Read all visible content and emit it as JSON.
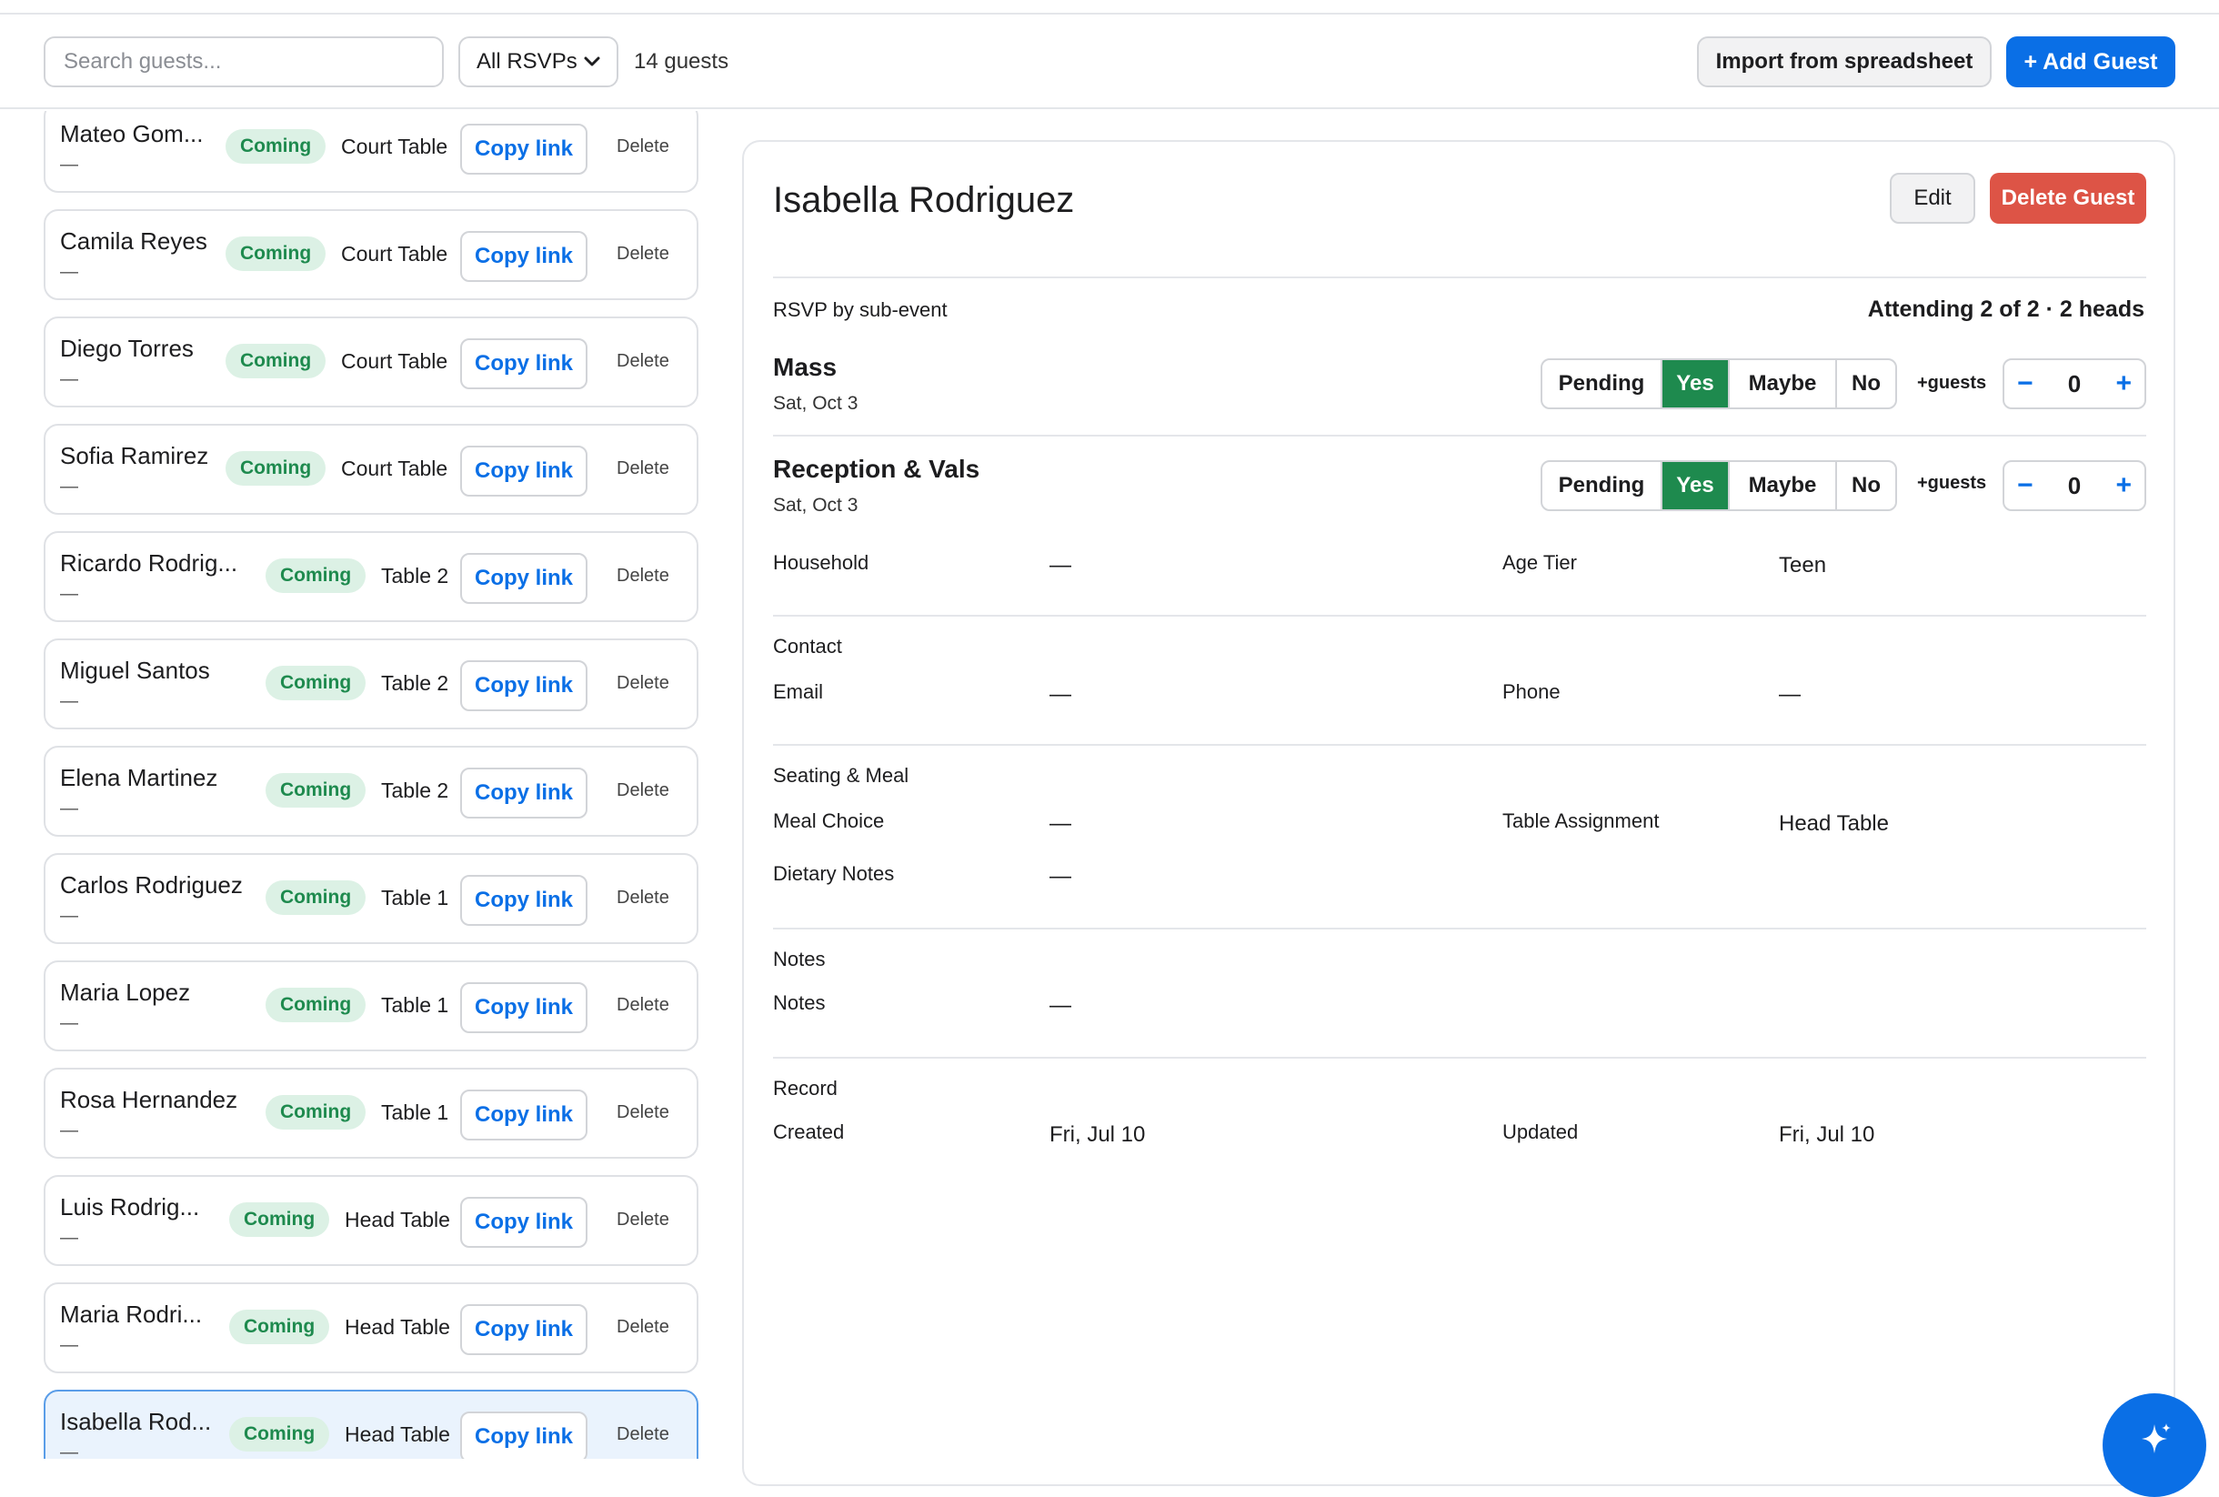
{
  "toolbar": {
    "search_placeholder": "Search guests...",
    "filter_value": "All RSVPs",
    "guest_count": "14 guests",
    "import_label": "Import from spreadsheet",
    "add_label": "+ Add Guest"
  },
  "guest_list": {
    "copy_label": "Copy link",
    "delete_label": "Delete",
    "badge_label": "Coming",
    "dash": "—",
    "rows": [
      {
        "name": "Mateo Gom...",
        "table": "Court Table"
      },
      {
        "name": "Camila Reyes",
        "table": "Court Table"
      },
      {
        "name": "Diego Torres",
        "table": "Court Table"
      },
      {
        "name": "Sofia Ramirez",
        "table": "Court Table"
      },
      {
        "name": "Ricardo Rodrig...",
        "table": "Table 2"
      },
      {
        "name": "Miguel Santos",
        "table": "Table 2"
      },
      {
        "name": "Elena Martinez",
        "table": "Table 2"
      },
      {
        "name": "Carlos Rodriguez",
        "table": "Table 1"
      },
      {
        "name": "Maria Lopez",
        "table": "Table 1"
      },
      {
        "name": "Rosa Hernandez",
        "table": "Table 1"
      },
      {
        "name": "Luis Rodrig...",
        "table": "Head Table"
      },
      {
        "name": "Maria Rodri...",
        "table": "Head Table"
      },
      {
        "name": "Isabella Rod...",
        "table": "Head Table"
      }
    ]
  },
  "detail": {
    "name": "Isabella Rodriguez",
    "edit_label": "Edit",
    "delete_label": "Delete Guest",
    "rsvp_heading": "RSVP by sub-event",
    "attending_summary": "Attending 2 of 2 · 2 heads",
    "rsvp_options": [
      "Pending",
      "Yes",
      "Maybe",
      "No"
    ],
    "plus_guests_label": "+guests",
    "stepper_minus": "−",
    "stepper_plus": "+",
    "events": [
      {
        "name": "Mass",
        "date": "Sat, Oct 3",
        "selected": "Yes",
        "extra_guests": "0"
      },
      {
        "name": "Reception & Vals",
        "date": "Sat, Oct 3",
        "selected": "Yes",
        "extra_guests": "0"
      }
    ],
    "household_label": "Household",
    "household_value": "—",
    "age_tier_label": "Age Tier",
    "age_tier_value": "Teen",
    "contact_heading": "Contact",
    "email_label": "Email",
    "email_value": "—",
    "phone_label": "Phone",
    "phone_value": "—",
    "seating_heading": "Seating & Meal",
    "meal_label": "Meal Choice",
    "meal_value": "—",
    "table_label": "Table Assignment",
    "table_value": "Head Table",
    "dietary_label": "Dietary Notes",
    "dietary_value": "—",
    "notes_heading": "Notes",
    "notes_label": "Notes",
    "notes_value": "—",
    "record_heading": "Record",
    "created_label": "Created",
    "created_value": "Fri, Jul 10",
    "updated_label": "Updated",
    "updated_value": "Fri, Jul 10"
  },
  "colors": {
    "accent": "#0a6fe6",
    "success": "#1e8a4e",
    "danger": "#dd5446"
  },
  "icons": {
    "fab": "sparkle-icon",
    "filter": "chevron-down-icon"
  }
}
